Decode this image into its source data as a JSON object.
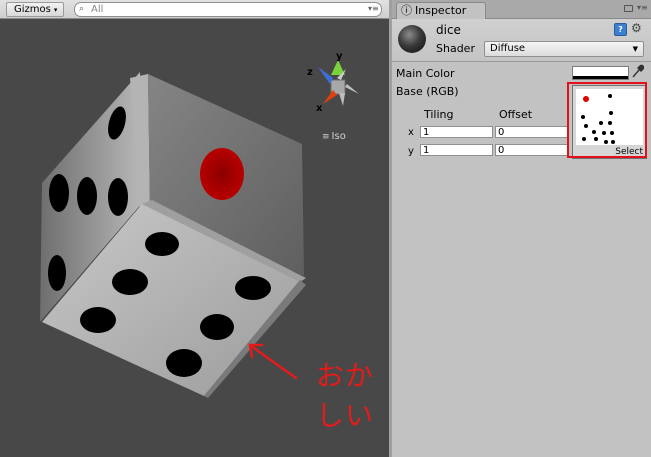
{
  "scene": {
    "toolbar": {
      "gizmos_label": "Gizmos",
      "gizmos_arrow": "▾",
      "search_placeholder": "All",
      "search_icon": "search-icon",
      "menu_icon": "▾≡"
    },
    "axes": {
      "x": "x",
      "y": "y",
      "z": "z"
    },
    "projection_label": "Iso",
    "projection_icon": "≡"
  },
  "inspector": {
    "tab_label": "Inspector",
    "tab_icon": "ⓘ",
    "menu_icon": "▾≡",
    "material": {
      "name": "dice",
      "shader_label": "Shader",
      "shader_value": "Diffuse",
      "dropdown_arrow": "▼",
      "help_icon": "?",
      "gear_icon": "⚙"
    },
    "main_color_label": "Main Color",
    "main_color": "#ffffff",
    "base_label": "Base (RGB)",
    "tiling_label": "Tiling",
    "offset_label": "Offset",
    "x_label": "x",
    "y_label": "y",
    "tiling_x": "1",
    "tiling_y": "1",
    "offset_x": "0",
    "offset_y": "0",
    "texture_select_label": "Select"
  },
  "annotation": {
    "text": "おかしい",
    "color": "#e31b1b"
  }
}
